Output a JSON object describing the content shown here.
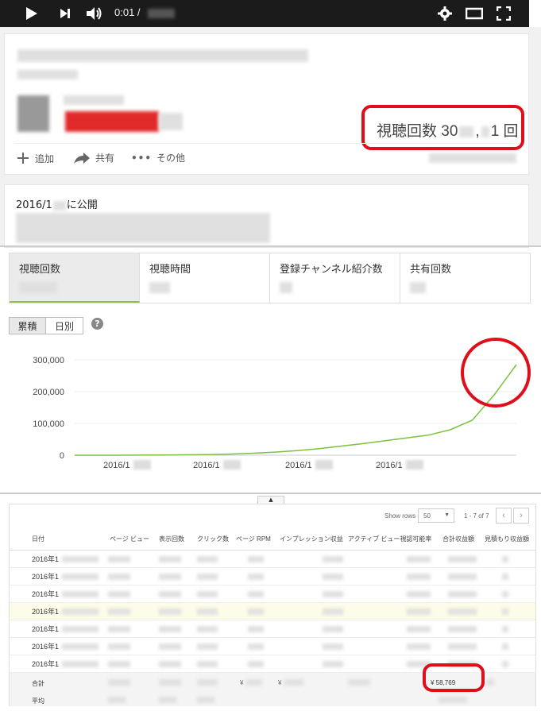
{
  "player": {
    "time": "0:01 /"
  },
  "video": {
    "views_label": "視聴回数 30",
    "views_mid": ",",
    "views_tail": "1 回",
    "actions": [
      {
        "label": "追加"
      },
      {
        "label": "共有"
      },
      {
        "label": "その他"
      }
    ],
    "published_prefix": "2016/1",
    "published_suffix": "に公開"
  },
  "metrics": {
    "tabs": [
      {
        "label": "視聴回数"
      },
      {
        "label": "視聴時間"
      },
      {
        "label": "登録チャンネル紹介数"
      },
      {
        "label": "共有回数"
      }
    ],
    "toggle_cumulative": "累積",
    "toggle_daily": "日別",
    "help": "?"
  },
  "chart_data": {
    "type": "line",
    "title": "",
    "xlabel": "",
    "ylabel": "",
    "y_ticks": [
      "300,000",
      "200,000",
      "100,000",
      "0"
    ],
    "ylim": [
      0,
      300000
    ],
    "x_tick_labels": [
      "2016/1",
      "2016/1",
      "2016/1",
      "2016/1"
    ],
    "x": [
      0,
      5,
      10,
      15,
      20,
      25,
      30,
      35,
      40,
      45,
      50,
      55,
      60,
      65,
      70,
      75,
      80,
      85,
      90,
      95,
      100
    ],
    "values": [
      0,
      0,
      0,
      300,
      600,
      1200,
      2000,
      3500,
      6000,
      9500,
      14000,
      20000,
      28000,
      36000,
      45000,
      54000,
      63000,
      80000,
      110000,
      190000,
      285000
    ],
    "color": "#7cc241",
    "grid": true
  },
  "table": {
    "show_rows_label": "Show rows",
    "show_rows_value": "50",
    "pagination": "1 - 7 of 7",
    "headers": [
      "日付",
      "ページ ビュー",
      "表示回数",
      "クリック数",
      "ページ RPM",
      "インプレッション収益",
      "アクティブ ビュー視認可能率",
      "合計収益額",
      "見積もり収益額"
    ],
    "rows": [
      {
        "date": "2016年1"
      },
      {
        "date": "2016年1"
      },
      {
        "date": "2016年1"
      },
      {
        "date": "2016年1"
      },
      {
        "date": "2016年1"
      },
      {
        "date": "2016年1"
      },
      {
        "date": "2016年1"
      }
    ],
    "total_label": "合計",
    "average_label": "平均",
    "total_revenue": "¥ 58,769",
    "currency_sign": "¥"
  }
}
